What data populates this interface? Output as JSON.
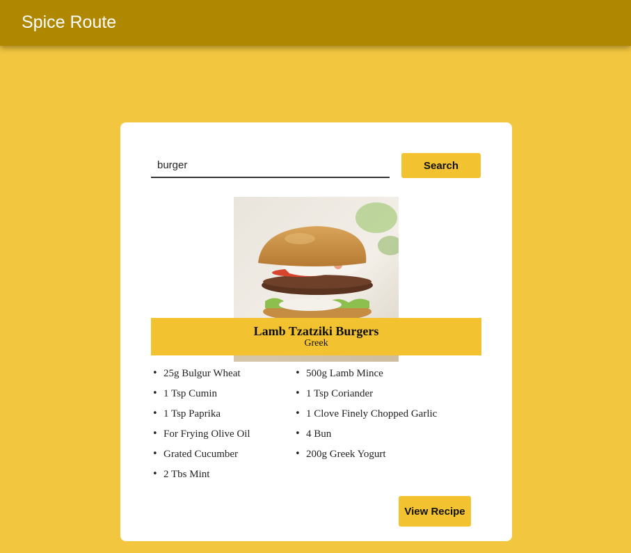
{
  "app_bar": {
    "title": "Spice Route"
  },
  "search": {
    "value": "burger",
    "button_label": "Search"
  },
  "recipe": {
    "title": "Lamb Tzatziki Burgers",
    "cuisine": "Greek",
    "image_icon": "burger-photo",
    "ingredients_left": [
      "25g Bulgur Wheat",
      "1 Tsp Cumin",
      "1 Tsp Paprika",
      "For Frying Olive Oil",
      "Grated Cucumber",
      "2 Tbs Mint"
    ],
    "ingredients_right": [
      "500g Lamb Mince",
      "1 Tsp Coriander",
      "1 Clove Finely Chopped Garlic",
      "4 Bun",
      "200g Greek Yogurt"
    ],
    "view_button_label": "View Recipe"
  },
  "colors": {
    "background": "#f2c63f",
    "app_bar": "#b08700",
    "accent": "#f2c230"
  }
}
